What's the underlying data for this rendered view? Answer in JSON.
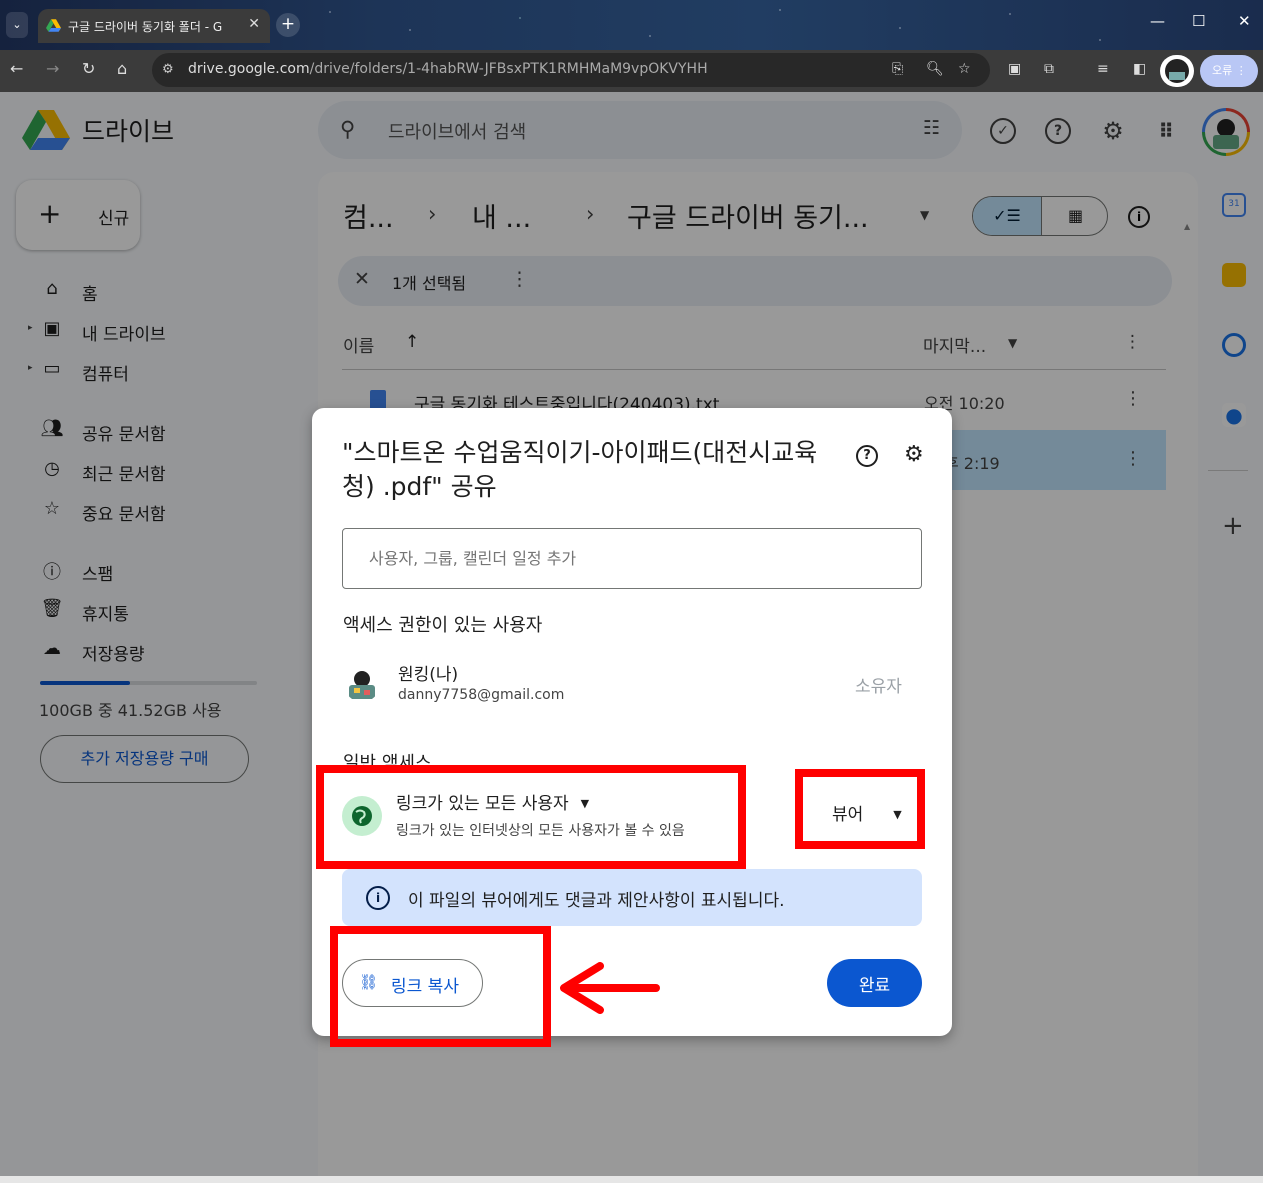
{
  "browser": {
    "tab_title": "구글 드라이버 동기화 폴더 - G",
    "url_host": "drive.google.com",
    "url_path": "/drive/folders/1-4habRW-JFBsxPTK1RMHMaM9vpOKVYHH",
    "error_chip": "오류"
  },
  "drive": {
    "app_name": "드라이브",
    "search_placeholder": "드라이브에서 검색",
    "new_label": "신규",
    "nav": [
      {
        "label": "홈",
        "icon": "home-icon"
      },
      {
        "label": "내 드라이브",
        "icon": "my-drive-icon"
      },
      {
        "label": "컴퓨터",
        "icon": "computer-icon"
      },
      {
        "label": "공유 문서함",
        "icon": "shared-icon"
      },
      {
        "label": "최근 문서함",
        "icon": "clock-icon"
      },
      {
        "label": "중요 문서함",
        "icon": "star-icon"
      },
      {
        "label": "스팸",
        "icon": "spam-icon"
      },
      {
        "label": "휴지통",
        "icon": "trash-icon"
      },
      {
        "label": "저장용량",
        "icon": "cloud-icon"
      }
    ],
    "storage_used_fraction": 0.4152,
    "storage_text": "100GB 중 41.52GB 사용",
    "buy_storage": "추가 저장용량 구매",
    "breadcrumb": [
      "컴...",
      "내 ...",
      "구글 드라이버 동기..."
    ],
    "selection_text": "1개 선택됨",
    "columns": {
      "name": "이름",
      "modified": "마지막..."
    },
    "files": [
      {
        "name": "구글 동기화 테스트중입니다(240403).txt",
        "date": "오전 10:20"
      },
      {
        "name": "",
        "date": "후 2:19"
      }
    ]
  },
  "dialog": {
    "title": "\"스마트온 수업움직이기-아이패드(대전시교육청) .pdf\" 공유",
    "add_placeholder": "사용자, 그룹, 캘린더 일정 추가",
    "people_section": "액세스 권한이 있는 사용자",
    "owner_name": "원킹(나)",
    "owner_email": "danny7758@gmail.com",
    "owner_role": "소유자",
    "general_section": "일반 액세스",
    "access_option": "링크가 있는 모든 사용자",
    "access_desc": "링크가 있는 인터넷상의 모든 사용자가 볼 수 있음",
    "role": "뷰어",
    "notice": "이 파일의 뷰어에게도 댓글과 제안사항이 표시됩니다.",
    "copy_link": "링크 복사",
    "done": "완료"
  },
  "colors": {
    "accent": "#0b57d0",
    "annotation": "#ff0000",
    "selected_row": "#c2e7ff"
  }
}
